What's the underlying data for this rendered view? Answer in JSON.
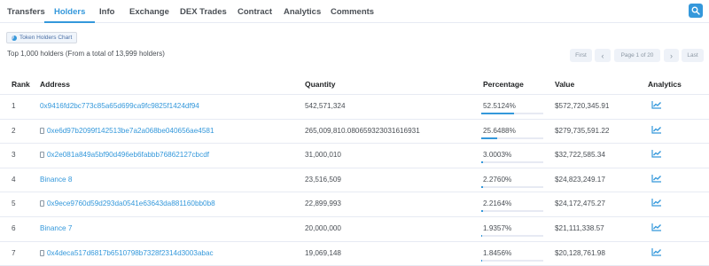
{
  "tabs": [
    "Transfers",
    "Holders",
    "Info",
    "Exchange",
    "DEX Trades",
    "Contract",
    "Analytics",
    "Comments"
  ],
  "active_tab": "Holders",
  "chart_button_label": "Token Holders Chart",
  "summary": "Top 1,000 holders (From a total of 13,999 holders)",
  "pagination": {
    "first": "First",
    "prev": "‹",
    "page": "Page 1 of 20",
    "next": "›",
    "last": "Last"
  },
  "columns": [
    "Rank",
    "Address",
    "Quantity",
    "Percentage",
    "Value",
    "Analytics"
  ],
  "colors": {
    "accent": "#3498db",
    "text": "#4a4f55",
    "border": "#e7eaf3"
  },
  "rows": [
    {
      "rank": "1",
      "address": "0x9416fd2bc773c85a65d699ca9fc9825f1424df94",
      "is_contract": false,
      "quantity": "542,571,324",
      "percentage": "52.5124%",
      "pct_value": 52.5124,
      "value": "$572,720,345.91"
    },
    {
      "rank": "2",
      "address": "0xe6d97b2099f142513be7a2a068be040656ae4581",
      "is_contract": true,
      "quantity": "265,009,810.080659323031616931",
      "percentage": "25.6488%",
      "pct_value": 25.6488,
      "value": "$279,735,591.22"
    },
    {
      "rank": "3",
      "address": "0x2e081a849a5bf90d496eb6fabbb76862127cbcdf",
      "is_contract": true,
      "quantity": "31,000,010",
      "percentage": "3.0003%",
      "pct_value": 3.0003,
      "value": "$32,722,585.34"
    },
    {
      "rank": "4",
      "address": "Binance 8",
      "is_contract": false,
      "quantity": "23,516,509",
      "percentage": "2.2760%",
      "pct_value": 2.276,
      "value": "$24,823,249.17"
    },
    {
      "rank": "5",
      "address": "0x9ece9760d59d293da0541e63643da881160bb0b8",
      "is_contract": true,
      "quantity": "22,899,993",
      "percentage": "2.2164%",
      "pct_value": 2.2164,
      "value": "$24,172,475.27"
    },
    {
      "rank": "6",
      "address": "Binance 7",
      "is_contract": false,
      "quantity": "20,000,000",
      "percentage": "1.9357%",
      "pct_value": 1.9357,
      "value": "$21,111,338.57"
    },
    {
      "rank": "7",
      "address": "0x4deca517d6817b6510798b7328f2314d3003abac",
      "is_contract": true,
      "quantity": "19,069,148",
      "percentage": "1.8456%",
      "pct_value": 1.8456,
      "value": "$20,128,761.98"
    }
  ]
}
